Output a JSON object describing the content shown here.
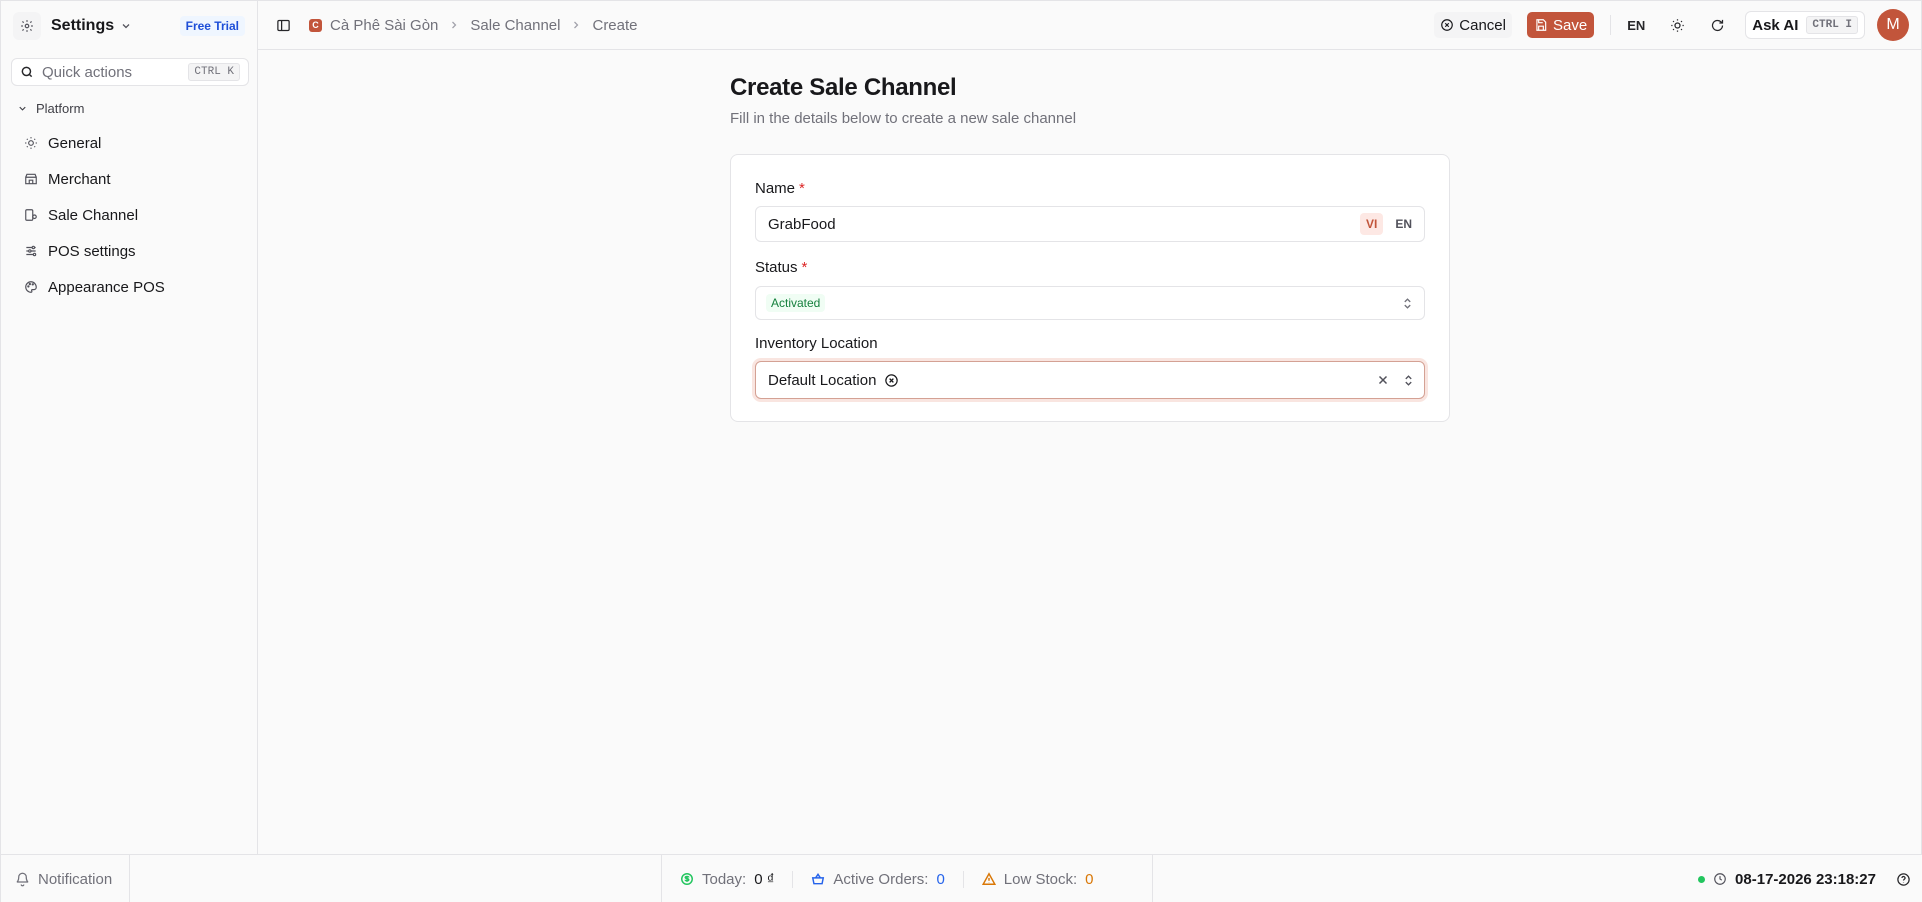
{
  "app": {
    "title": "Settings",
    "badge": "Free Trial"
  },
  "sidebar": {
    "quick_actions": {
      "label": "Quick actions",
      "shortcut": "CTRL K"
    },
    "group_label": "Platform",
    "items": [
      {
        "label": "General",
        "icon": "sun-gear-icon"
      },
      {
        "label": "Merchant",
        "icon": "store-icon"
      },
      {
        "label": "Sale Channel",
        "icon": "channel-icon"
      },
      {
        "label": "POS settings",
        "icon": "sliders-icon"
      },
      {
        "label": "Appearance POS",
        "icon": "palette-icon"
      }
    ]
  },
  "breadcrumb": {
    "store_initial": "C",
    "store": "Cà Phê Sài Gòn",
    "section": "Sale Channel",
    "current": "Create"
  },
  "topbar": {
    "cancel_label": "Cancel",
    "save_label": "Save",
    "language": "EN",
    "ask_ai_label": "Ask AI",
    "ask_ai_shortcut": "CTRL I",
    "avatar_initial": "M"
  },
  "page": {
    "title": "Create Sale Channel",
    "subtitle": "Fill in the details below to create a new sale channel"
  },
  "form": {
    "name": {
      "label": "Name",
      "required_mark": "*",
      "value": "GrabFood",
      "lang_tabs": [
        "VI",
        "EN"
      ],
      "active_lang": "VI"
    },
    "status": {
      "label": "Status",
      "required_mark": "*",
      "value": "Activated"
    },
    "inventory": {
      "label": "Inventory Location",
      "selected": "Default Location"
    }
  },
  "statusbar": {
    "notification_label": "Notification",
    "today_label": "Today:",
    "today_value": "0 ₫",
    "active_orders_label": "Active Orders:",
    "active_orders_value": "0",
    "low_stock_label": "Low Stock:",
    "low_stock_value": "0",
    "datetime": "08-17-2026 23:18:27"
  },
  "colors": {
    "accent": "#c2553b",
    "success": "#22c55e",
    "link_blue": "#2563eb",
    "warning": "#d97706"
  }
}
